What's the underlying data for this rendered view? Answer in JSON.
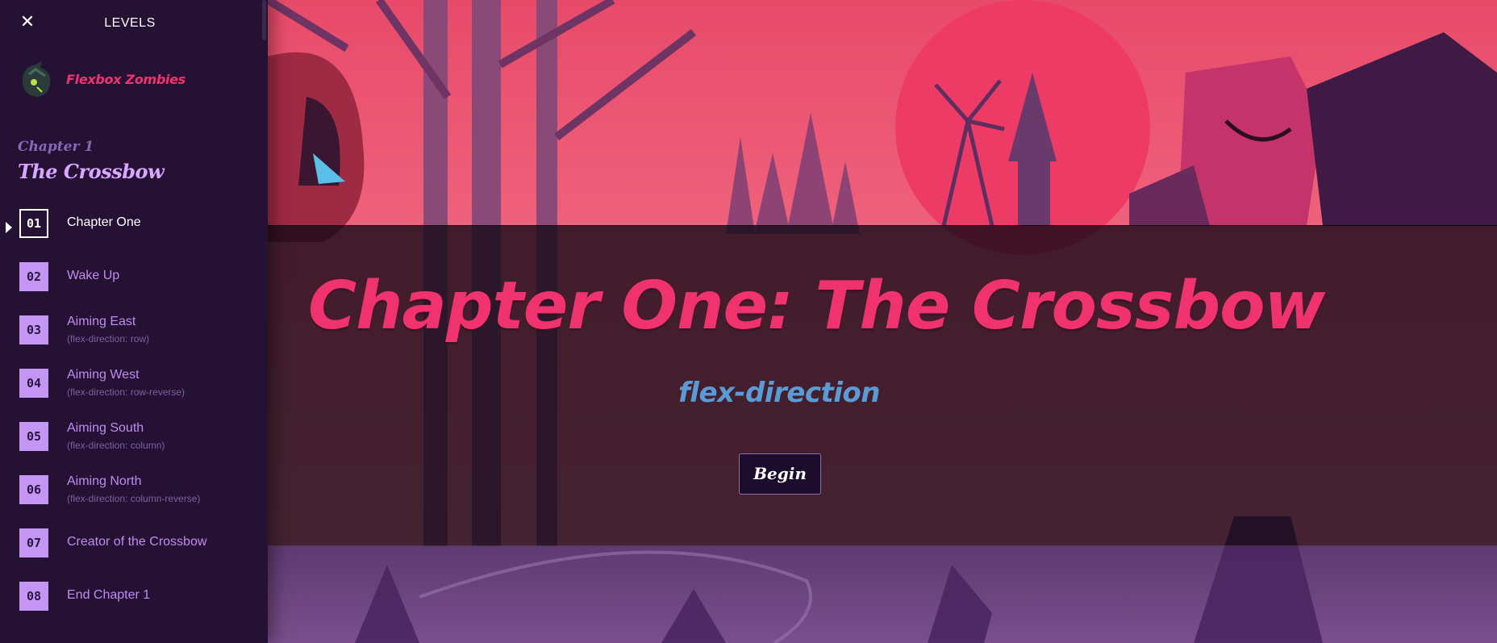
{
  "sidebar": {
    "title": "LEVELS",
    "close_icon": "close-icon",
    "brand": {
      "name": "Flexbox Zombies",
      "logo_icon": "zombie-logo-icon"
    },
    "chapter": {
      "kicker": "Chapter 1",
      "name": "The Crossbow"
    },
    "levels": [
      {
        "num": "01",
        "label": "Chapter One",
        "sub": "",
        "current": true
      },
      {
        "num": "02",
        "label": "Wake Up",
        "sub": ""
      },
      {
        "num": "03",
        "label": "Aiming East",
        "sub": "(flex-direction: row)"
      },
      {
        "num": "04",
        "label": "Aiming West",
        "sub": "(flex-direction: row-reverse)"
      },
      {
        "num": "05",
        "label": "Aiming South",
        "sub": "(flex-direction: column)"
      },
      {
        "num": "06",
        "label": "Aiming North",
        "sub": "(flex-direction: column-reverse)"
      },
      {
        "num": "07",
        "label": "Creator of the Crossbow",
        "sub": ""
      },
      {
        "num": "08",
        "label": "End Chapter 1",
        "sub": ""
      }
    ]
  },
  "banner": {
    "title": "Chapter One: The Crossbow",
    "subtitle": "flex-direction",
    "begin_label": "Begin"
  },
  "colors": {
    "accent_pink": "#f0336e",
    "accent_blue": "#5a9bd6",
    "level_badge": "#c496f4",
    "sidebar_bg": "#241133"
  }
}
